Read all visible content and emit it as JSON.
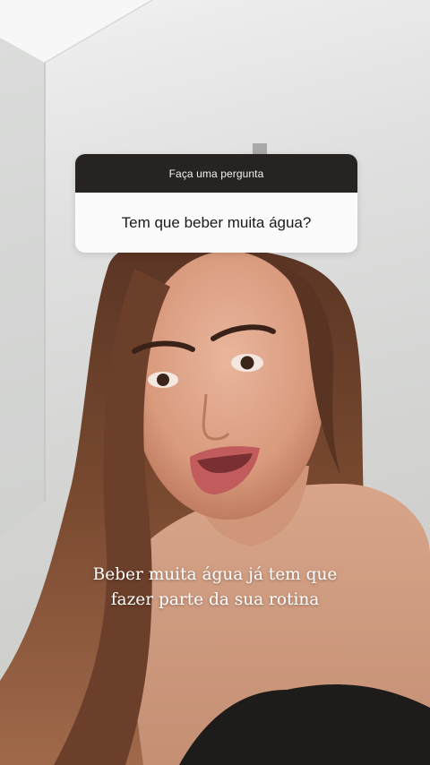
{
  "question_sticker": {
    "header": "Faça uma pergunta",
    "question": "Tem que beber muita água?"
  },
  "caption": {
    "line1": "Beber muita água já tem que",
    "line2": "fazer parte da sua rotina"
  }
}
